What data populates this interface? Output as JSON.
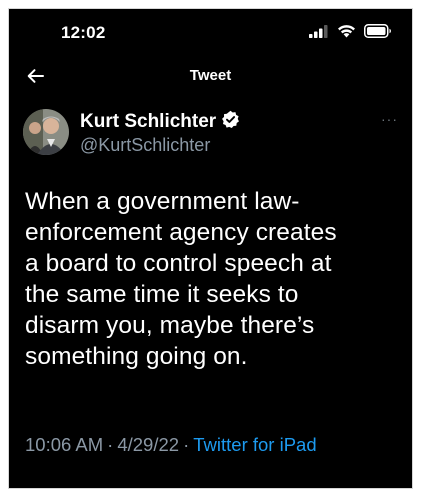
{
  "status_bar": {
    "time": "12:02",
    "icons": [
      "cellular-signal-icon",
      "wifi-icon",
      "battery-icon"
    ]
  },
  "nav": {
    "back_icon": "arrow-left-icon",
    "title": "Tweet"
  },
  "author": {
    "display_name": "Kurt Schlichter",
    "handle": "@KurtSchlichter",
    "verified_icon": "verified-badge-icon",
    "more_icon": "more-options-icon",
    "more_label": "···"
  },
  "tweet": {
    "lines": [
      "When a government law-",
      "enforcement agency creates",
      "a board to control speech at",
      "the same time it seeks to",
      "disarm you, maybe there’s",
      "something going on."
    ]
  },
  "meta": {
    "time": "10:06 AM",
    "separator": "·",
    "date": "4/29/22",
    "source": "Twitter for iPad"
  },
  "colors": {
    "background": "#000000",
    "text": "#ffffff",
    "secondary": "#8b98a5",
    "link": "#1d9bf0"
  }
}
